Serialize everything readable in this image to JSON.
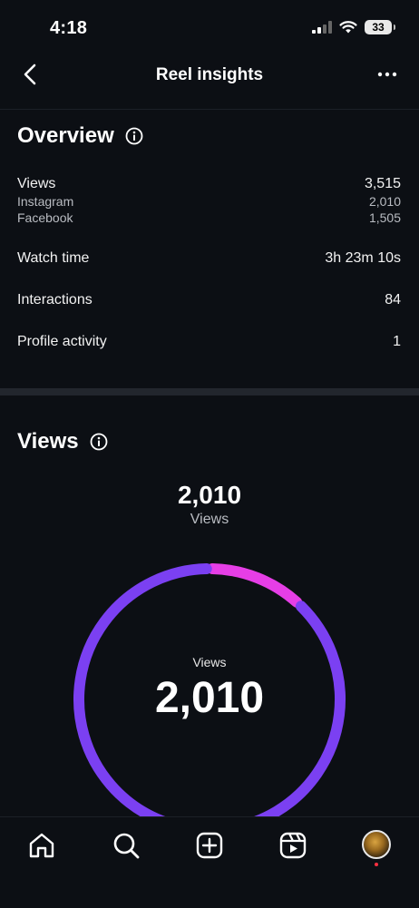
{
  "status_bar": {
    "time": "4:18",
    "battery": "33"
  },
  "header": {
    "title": "Reel insights"
  },
  "overview": {
    "title": "Overview",
    "views": {
      "label": "Views",
      "value": "3,515"
    },
    "instagram": {
      "label": "Instagram",
      "value": "2,010"
    },
    "facebook": {
      "label": "Facebook",
      "value": "1,505"
    },
    "watch_time": {
      "label": "Watch time",
      "value": "3h 23m 10s"
    },
    "interactions": {
      "label": "Interactions",
      "value": "84"
    },
    "profile_activity": {
      "label": "Profile activity",
      "value": "1"
    }
  },
  "views_section": {
    "title": "Views",
    "total": "2,010",
    "total_label": "Views",
    "donut_label": "Views",
    "donut_value": "2,010",
    "chart_data": {
      "type": "pie",
      "colors": [
        "#7b40f2",
        "#e63ee6"
      ],
      "segments": [
        {
          "share": 0.88,
          "color": "#7b40f2"
        },
        {
          "share": 0.12,
          "color": "#e63ee6"
        }
      ]
    }
  },
  "tab_bar": {
    "items": [
      "home-icon",
      "search-icon",
      "create-icon",
      "reels-icon",
      "profile-avatar"
    ]
  }
}
